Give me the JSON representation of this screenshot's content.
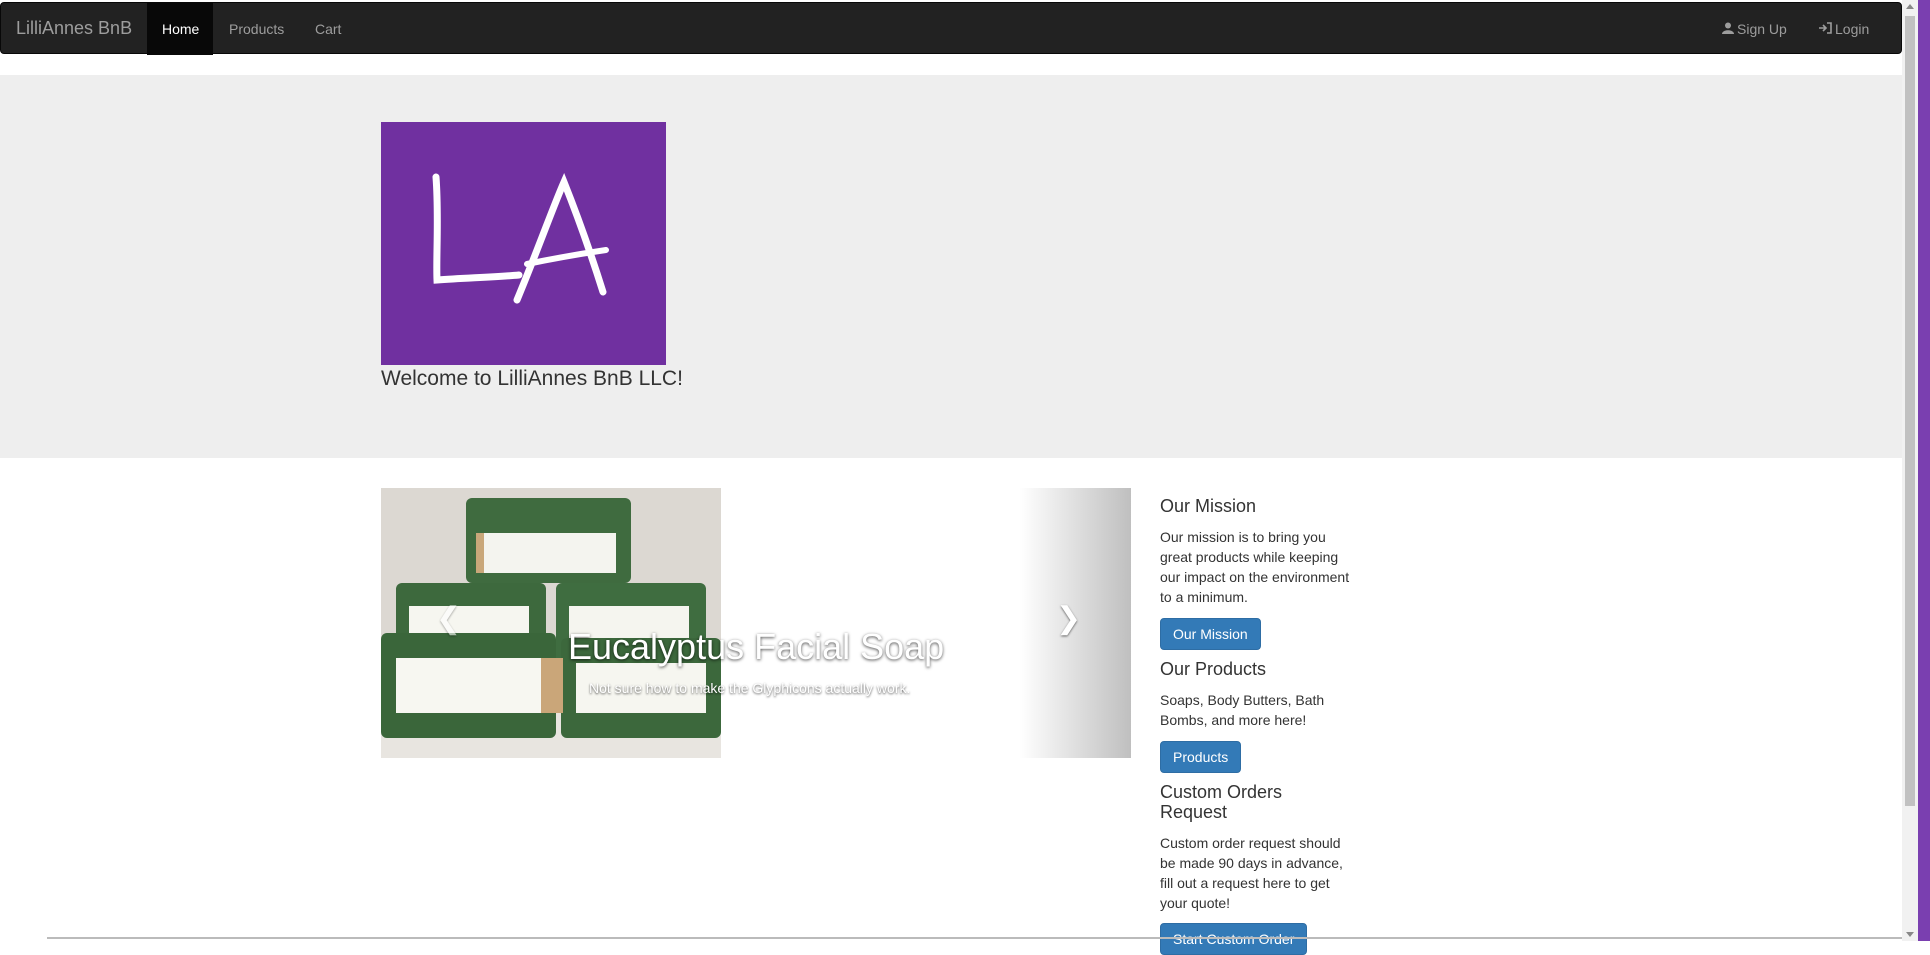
{
  "navbar": {
    "brand": "LilliAnnes BnB",
    "items": [
      {
        "label": "Home",
        "active": true
      },
      {
        "label": "Products"
      },
      {
        "label": "Cart"
      }
    ],
    "right": [
      {
        "label": "Sign Up",
        "icon": "user-icon"
      },
      {
        "label": "Login",
        "icon": "log-in-icon"
      }
    ]
  },
  "jumbotron": {
    "logo_text": "LA",
    "logo_color": "#7030a0",
    "welcome": "Welcome to LilliAnnes BnB LLC!"
  },
  "carousel": {
    "caption_title": "Eucalyptus Facial Soap",
    "caption_sub": "Not sure how to make the Glyphicons actually work.",
    "prev_icon": "chevron-left-icon",
    "next_icon": "chevron-right-icon"
  },
  "sections": [
    {
      "title": "Our Mission",
      "text": "Our mission is to bring you great products while keeping our impact on the environment to a minimum.",
      "button": "Our Mission"
    },
    {
      "title": "Our Products",
      "text": "Soaps, Body Butters, Bath Bombs, and more here!",
      "button": "Products"
    },
    {
      "title": "Custom Orders Request",
      "text": "Custom order request should be made 90 days in advance, fill out a request here to get your quote!",
      "button": "Start Custom Order"
    }
  ],
  "colors": {
    "navbar": "#222222",
    "jumbotron": "#eeeeee",
    "primary": "#337ab7",
    "window_edge": "#7a3fb0"
  }
}
